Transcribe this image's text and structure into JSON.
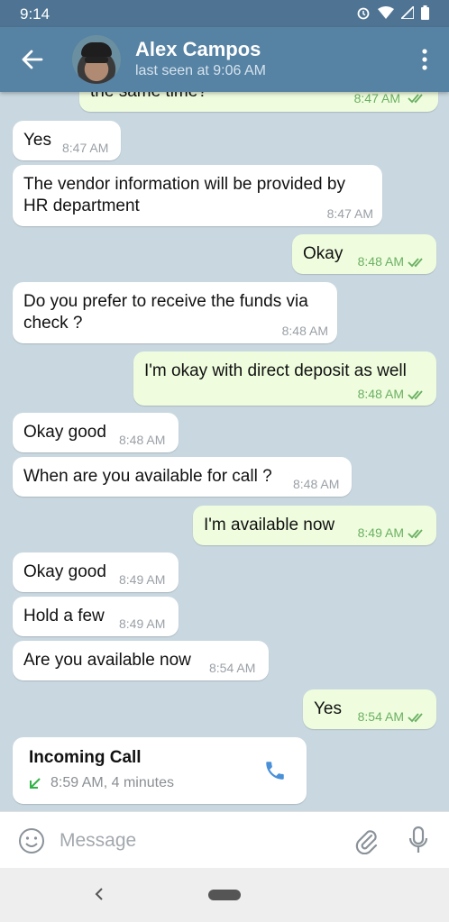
{
  "status_bar": {
    "time": "9:14"
  },
  "header": {
    "name": "Alex Campos",
    "status": "last seen at 9:06 AM"
  },
  "messages": [
    {
      "dir": "out",
      "text": "the same time?",
      "time": "8:47 AM",
      "read": true
    },
    {
      "dir": "in",
      "text": "Yes",
      "time": "8:47 AM"
    },
    {
      "dir": "in",
      "text": "The vendor information will be provided by\nHR department",
      "time": "8:47 AM"
    },
    {
      "dir": "out",
      "text": "Okay",
      "time": "8:48 AM",
      "read": true
    },
    {
      "dir": "in",
      "text": "Do you prefer to receive the funds via\ncheck ?",
      "time": "8:48 AM"
    },
    {
      "dir": "out",
      "text": "I'm okay with direct deposit as well",
      "time": "8:48 AM",
      "read": true
    },
    {
      "dir": "in",
      "text": "Okay good",
      "time": "8:48 AM"
    },
    {
      "dir": "in",
      "text": "When are you available for call ?",
      "time": "8:48 AM"
    },
    {
      "dir": "out",
      "text": "I'm available now",
      "time": "8:49 AM",
      "read": true
    },
    {
      "dir": "in",
      "text": "Okay good",
      "time": "8:49 AM"
    },
    {
      "dir": "in",
      "text": "Hold a few",
      "time": "8:49 AM"
    },
    {
      "dir": "in",
      "text": "Are you available now",
      "time": "8:54 AM"
    },
    {
      "dir": "out",
      "text": "Yes",
      "time": "8:54 AM",
      "read": true
    }
  ],
  "call": {
    "title": "Incoming Call",
    "detail": "8:59 AM, 4 minutes"
  },
  "input": {
    "placeholder": "Message"
  },
  "colors": {
    "header": "#5682a3",
    "outgoing_bubble": "#effdde",
    "incoming_bubble": "#ffffff",
    "accent": "#4a90d9"
  }
}
